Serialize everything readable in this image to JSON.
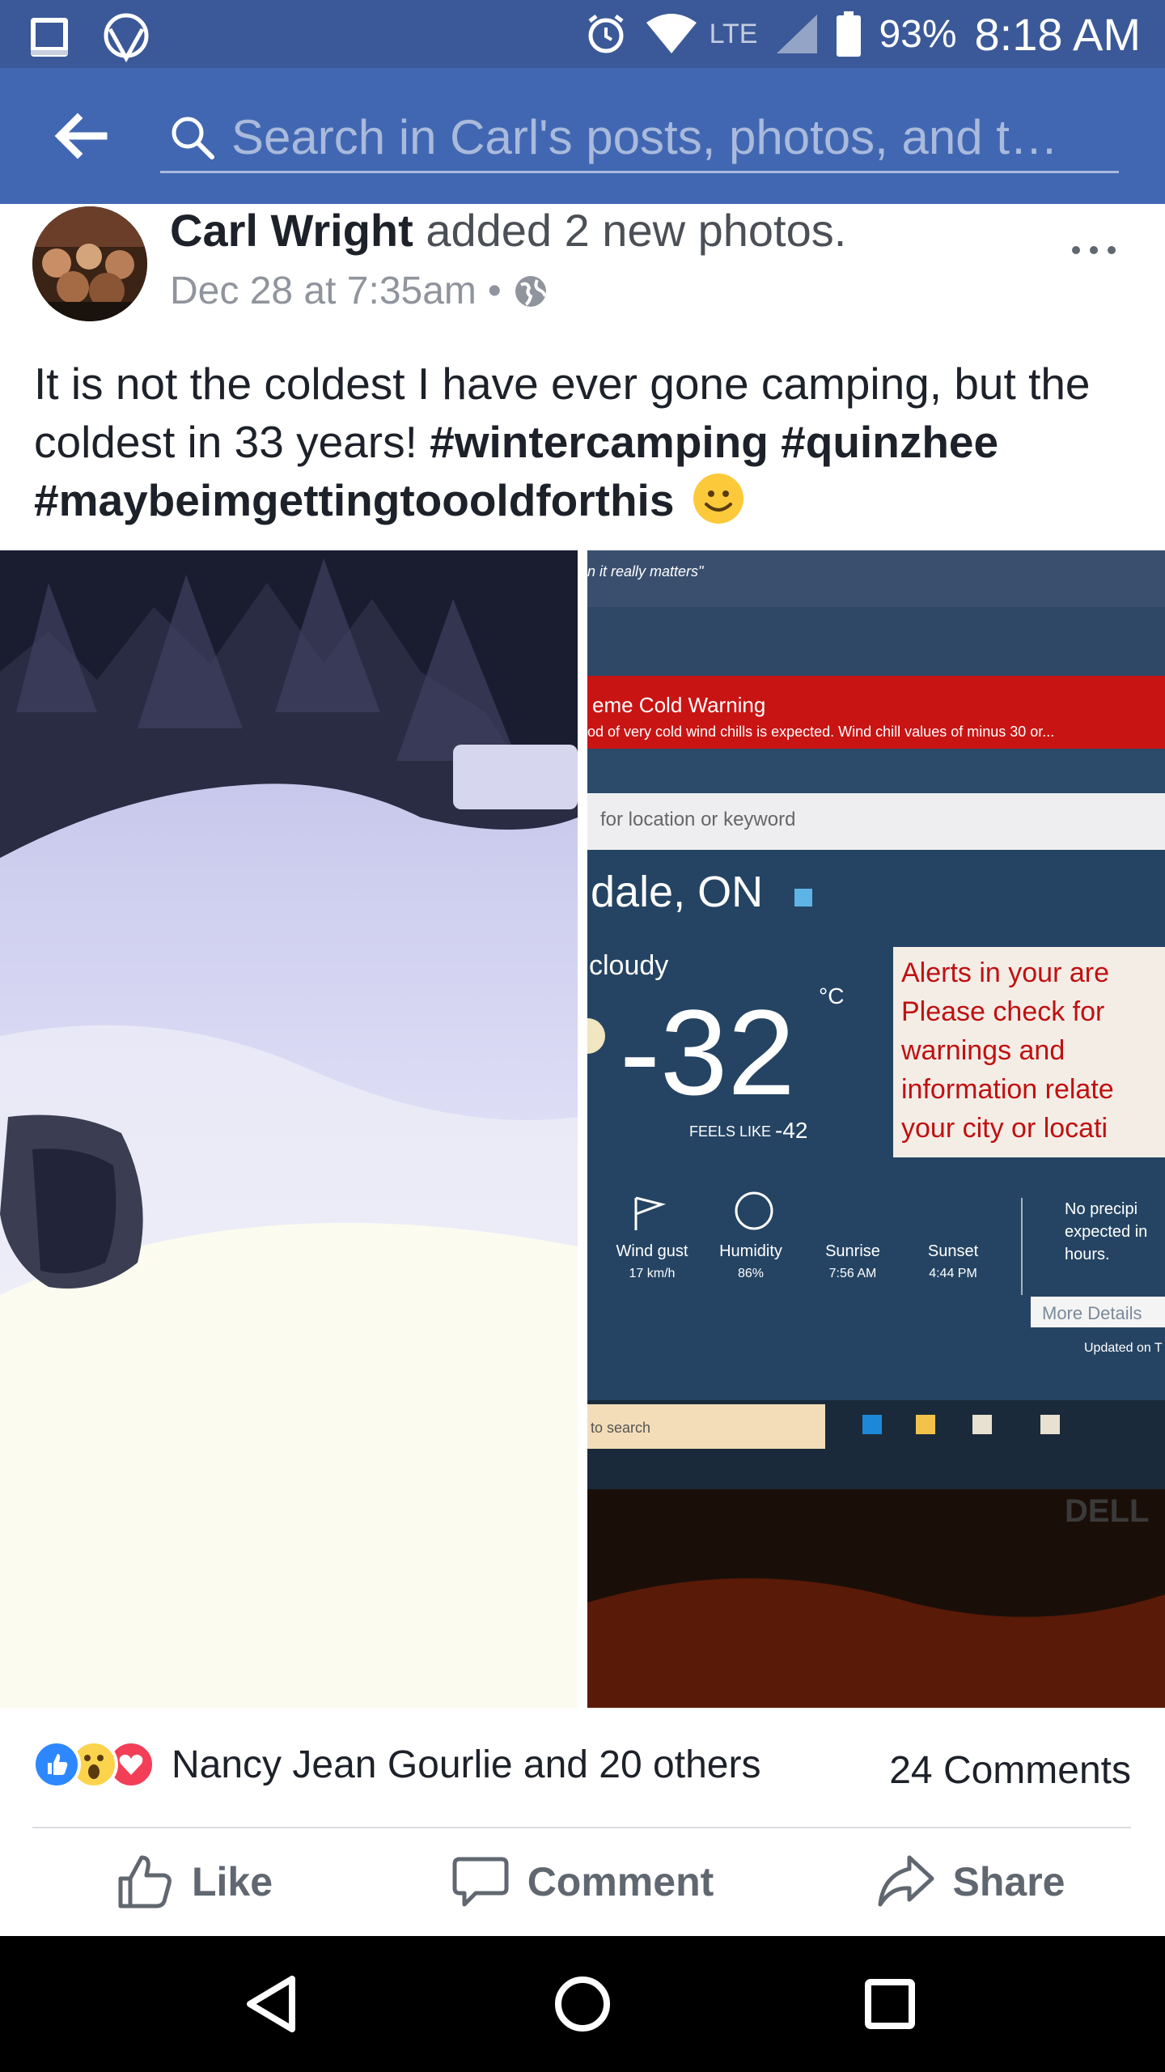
{
  "status_bar": {
    "network": "LTE",
    "battery": "93%",
    "time": "8:18 AM"
  },
  "header": {
    "search_placeholder": "Search in Carl's posts, photos, and t…"
  },
  "post": {
    "author": "Carl Wright",
    "action": " added 2 new photos.",
    "timestamp": "Dec 28 at 7:35am",
    "meta_separator": "•",
    "text_plain": "It is not the coldest I have ever gone camping, but the coldest in 33 years! ",
    "hashtags": [
      "#wintercamping",
      "#quinzhee",
      "#maybeimgettingtoooldforthis"
    ],
    "photos": [
      {
        "alt": "snow shelter photo"
      },
      {
        "alt": "weather screen photo",
        "screen": {
          "tagline": "n it really matters\"",
          "warning_title": "eme Cold Warning",
          "warning_body": "od of very cold wind chills is expected. Wind chill values of minus 30 or...",
          "search_hint": "for location or keyword",
          "location": "dale, ON",
          "condition": "cloudy",
          "temperature": "-32",
          "unit": "°C",
          "feels_like_label": "FEELS LIKE",
          "feels_like_value": "-42",
          "alert_text": "Alerts in your are Please check for warnings and information relate your city or locati",
          "stats": [
            {
              "label": "Wind gust",
              "value": "17 km/h"
            },
            {
              "label": "Humidity",
              "value": "86%"
            },
            {
              "label": "Sunrise",
              "value": "7:56 AM"
            },
            {
              "label": "Sunset",
              "value": "4:44 PM"
            }
          ],
          "precip": "No precipi expected in hours.",
          "more_details": "More Details",
          "updated": "Updated on T",
          "taskbar_search": "to search",
          "brand": "DELL"
        }
      }
    ]
  },
  "engagement": {
    "reactions_text": "Nancy Jean Gourlie and 20 others",
    "comments": "24 Comments"
  },
  "actions": {
    "like": "Like",
    "comment": "Comment",
    "share": "Share"
  }
}
